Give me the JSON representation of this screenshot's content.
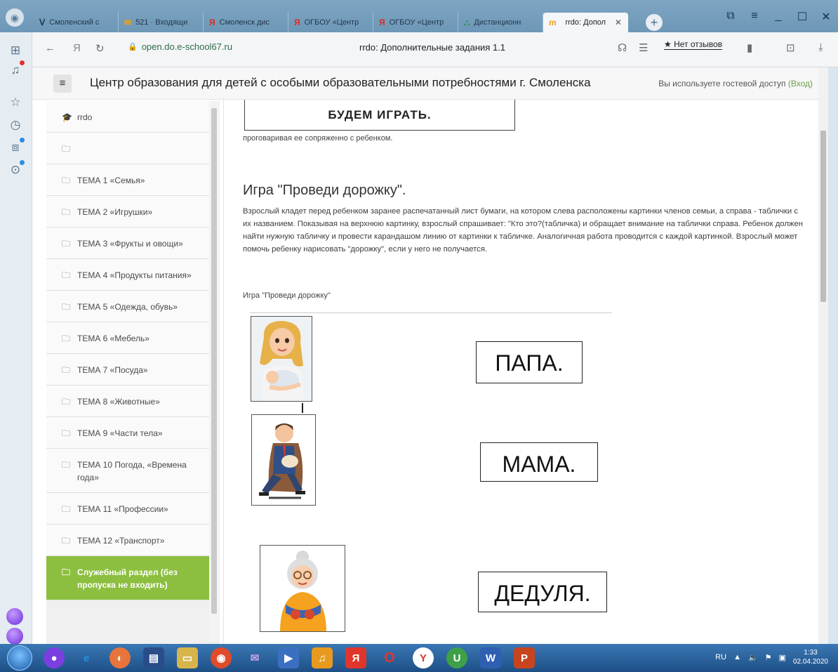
{
  "browser": {
    "tabs": [
      {
        "label": "Смоленский с",
        "favicon": "vk-icon"
      },
      {
        "label": "521 · Входящи",
        "favicon": "mail-icon"
      },
      {
        "label": "Смоленск дис",
        "favicon": "yandex-icon"
      },
      {
        "label": "ОГБОУ «Центр",
        "favicon": "yandex-icon"
      },
      {
        "label": "ОГБОУ «Центр",
        "favicon": "yandex-icon"
      },
      {
        "label": "Дистанционн",
        "favicon": "moodle-icon"
      },
      {
        "label": "rrdo: Допол",
        "favicon": "moodle-icon",
        "active": true
      }
    ],
    "url": "open.do.e-school67.ru",
    "page_title": "rrdo: Дополнительные задания 1.1",
    "reviews_label": "★ Нет отзывов"
  },
  "site": {
    "title": "Центр образования для детей с особыми образовательными потребностями г. Смоленска",
    "guest_text": "Вы используете гостевой доступ",
    "login_label": "(Вход)"
  },
  "nav": {
    "course": "rrdo",
    "items": [
      {
        "label": ""
      },
      {
        "label": "ТЕМА 1 «Семья»"
      },
      {
        "label": "ТЕМА 2 «Игрушки»"
      },
      {
        "label": "ТЕМА 3 «Фрукты и овощи»"
      },
      {
        "label": "ТЕМА 4 «Продукты питания»"
      },
      {
        "label": "ТЕМА 5 «Одежда, обувь»"
      },
      {
        "label": "ТЕМА 6 «Мебель»"
      },
      {
        "label": "ТЕМА 7 «Посуда»"
      },
      {
        "label": "ТЕМА 8 «Животные»"
      },
      {
        "label": "ТЕМА 9 «Части тела»"
      },
      {
        "label": "ТЕМА 10 Погода, «Времена года»"
      },
      {
        "label": "ТЕМА 11 «Профессии»"
      },
      {
        "label": "ТЕМА 12 «Транспорт»"
      },
      {
        "label": "Служебный раздел (без пропуска не входить)",
        "active": true
      }
    ]
  },
  "content": {
    "play_box": "БУДЕМ ИГРАТЬ.",
    "prev_text": "проговаривая ее сопряженно с ребенком.",
    "game_heading": "Игра \"Проведи дорожку\".",
    "game_description": "Взрослый кладет перед ребенком заранее распечатанный лист бумаги, на котором слева расположены картинки членов семьи, а справа - таблички с их названием. Показывая на верхнюю картинку, взрослый спрашивает: \"Кто это?(табличка) и обращает внимание на таблички справа. Ребенок должен найти нужную табличку и провести карандашом линию от картинки к табличке. Аналогичная работа проводится с каждой картинкой. Взрослый может помочь ребенку нарисовать \"дорожку\", если у него не получается.",
    "game_caption": "Игра \"Проведи дорожку\"",
    "word_cards": [
      "ПАПА.",
      "МАМА.",
      "ДЕДУЛЯ."
    ]
  },
  "taskbar": {
    "lang": "RU",
    "time": "1:33",
    "date": "02.04.2020"
  }
}
